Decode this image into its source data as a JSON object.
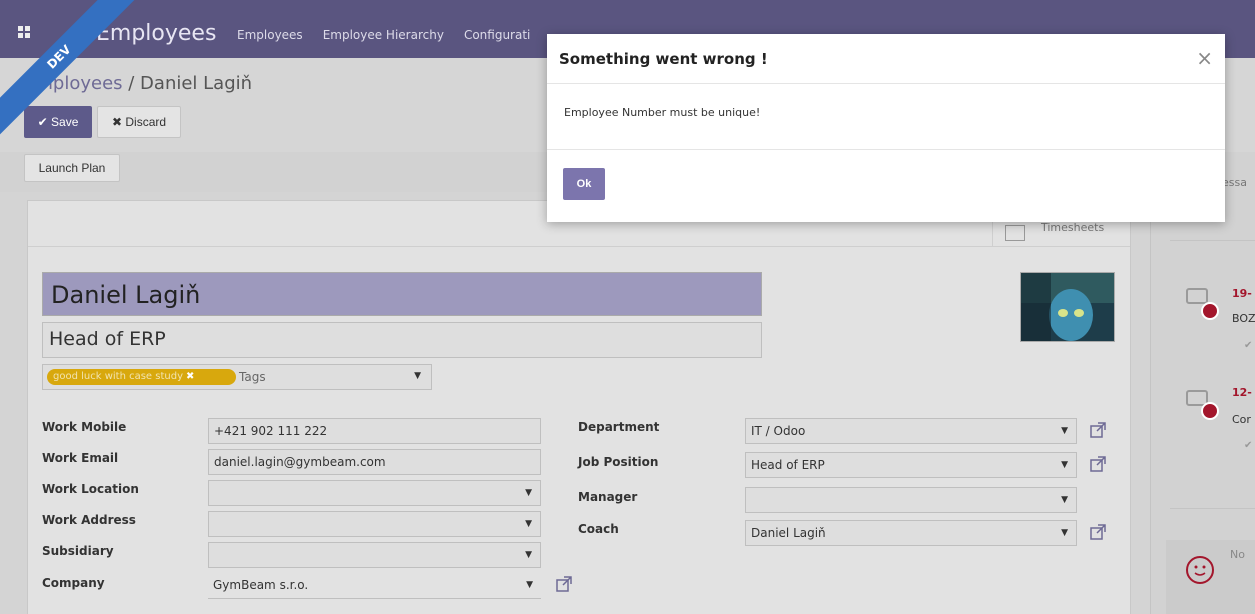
{
  "navbar": {
    "app_title": "Employees",
    "menu": [
      "Employees",
      "Employee Hierarchy",
      "Configurati"
    ]
  },
  "ribbon": {
    "label": "DEV"
  },
  "breadcrumb": {
    "parent": "Employees",
    "separator": " / ",
    "current": "Daniel Lagiň"
  },
  "toolbar": {
    "save_label": "Save",
    "discard_label": "Discard"
  },
  "status_bar": {
    "launch_plan_label": "Launch Plan"
  },
  "button_box": {
    "timesheets_label": "Timesheets"
  },
  "employee": {
    "name": "Daniel Lagiň",
    "job_title": "Head of ERP",
    "tags": [
      "good luck with case study"
    ],
    "tags_placeholder": "Tags"
  },
  "form": {
    "left": [
      {
        "label": "Work Mobile",
        "value": "+421 902 111 222",
        "type": "text"
      },
      {
        "label": "Work Email",
        "value": "daniel.lagin@gymbeam.com",
        "type": "text"
      },
      {
        "label": "Work Location",
        "value": "",
        "type": "select"
      },
      {
        "label": "Work Address",
        "value": "",
        "type": "select"
      },
      {
        "label": "Subsidiary",
        "value": "",
        "type": "select"
      },
      {
        "label": "Company",
        "value": "GymBeam s.r.o.",
        "type": "select"
      }
    ],
    "right": [
      {
        "label": "Department",
        "value": "IT / Odoo",
        "type": "select"
      },
      {
        "label": "Job Position",
        "value": "Head of ERP",
        "type": "select"
      },
      {
        "label": "Manager",
        "value": "",
        "type": "select"
      },
      {
        "label": "Coach",
        "value": "Daniel Lagiň",
        "type": "select"
      }
    ]
  },
  "chatter": {
    "send_message_snippet": "essa",
    "messages": [
      {
        "date": "19-",
        "snippet": "BOZ"
      },
      {
        "date": "12-",
        "snippet": "Cor"
      }
    ],
    "note_snippet": "No"
  },
  "modal": {
    "title": "Something went wrong !",
    "message": "Employee Number must be unique!",
    "ok_label": "Ok",
    "close_symbol": "×"
  },
  "colors": {
    "navbar": "#5a5580",
    "primary": "#5d5a8a",
    "ribbon": "#3470c1",
    "tag": "#d8a80d",
    "chatter_accent": "#a3162c"
  }
}
